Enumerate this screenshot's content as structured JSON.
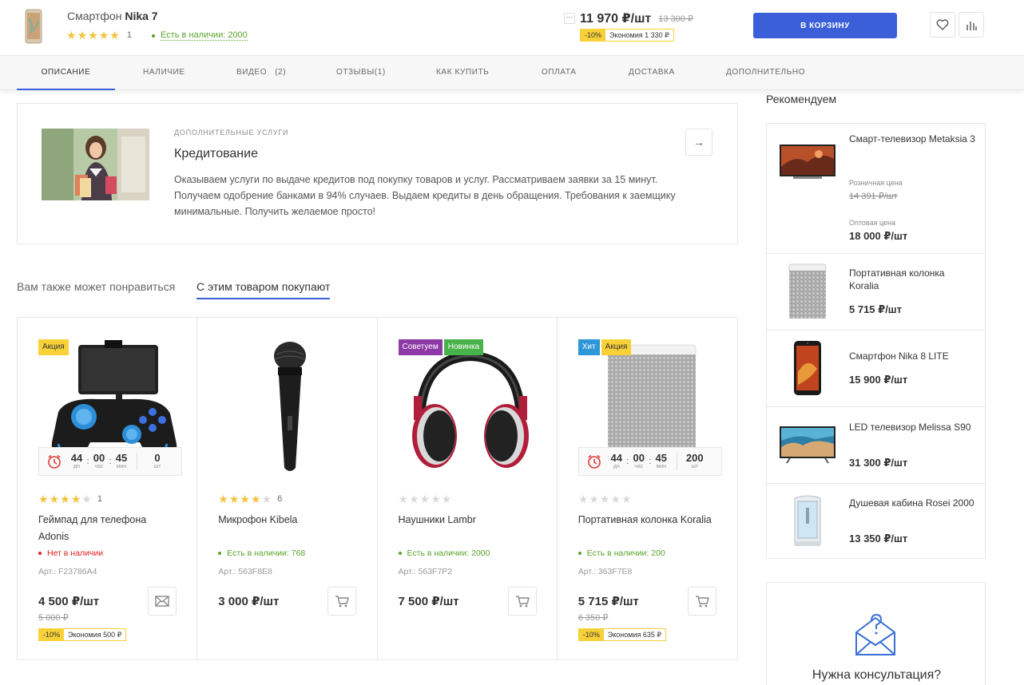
{
  "topbar": {
    "title_prefix": "Смартфон",
    "title_name": "Nika 7",
    "rating": 5,
    "reviews": "1",
    "stock": "Есть в наличии: 2000",
    "dots": "···",
    "price": "11 970 ₽/шт",
    "old_price": "13 300 ₽",
    "discount": "-10%",
    "savings": "Экономия 1 330 ₽",
    "cart_label": "В КОРЗИНУ"
  },
  "tabs": [
    {
      "label": "ОПИСАНИЕ",
      "active": true
    },
    {
      "label": "НАЛИЧИЕ"
    },
    {
      "label": "ВИДЕО   (2)"
    },
    {
      "label": "ОТЗЫВЫ(1)"
    },
    {
      "label": "КАК КУПИТЬ"
    },
    {
      "label": "ОПЛАТА"
    },
    {
      "label": "ДОСТАВКА"
    },
    {
      "label": "ДОПОЛНИТЕЛЬНО"
    }
  ],
  "credit": {
    "subtitle": "ДОПОЛНИТЕЛЬНЫЕ УСЛУГИ",
    "title": "Кредитование",
    "text": "Оказываем услуги по выдаче кредитов под покупку товаров и услуг. Рассматриваем заявки за 15 минут. Получаем одобрение банками в 94% случаев. Выдаем кредиты в день обращения. Требования к заемщику минимальные. Получить желаемое просто!"
  },
  "sections": {
    "tab1": "Вам также может понравиться",
    "tab2": "С этим товаром покупают"
  },
  "products": [
    {
      "badges": [
        {
          "label": "Акция",
          "type": "sale"
        }
      ],
      "timer": {
        "d": "44",
        "dl": "дн",
        "h": "00",
        "hl": "час",
        "m": "45",
        "ml": "мин",
        "q": "0",
        "ql": "шт"
      },
      "rating": 4,
      "reviews": "1",
      "name": "Геймпад для телефона Adonis",
      "stock": "Нет в наличии",
      "in_stock": false,
      "art": "Арт.: F23786A4",
      "price": "4 500 ₽/шт",
      "old_price": "5 000 ₽",
      "discount": "-10%",
      "savings": "Экономия 500 ₽",
      "button_icon": "mail-icon"
    },
    {
      "badges": [],
      "rating": 4,
      "reviews": "6",
      "name": "Микрофон Kibela",
      "stock": "Есть в наличии: 768",
      "in_stock": true,
      "art": "Арт.: 563F8E8",
      "price": "3 000 ₽/шт",
      "button_icon": "cart-icon"
    },
    {
      "badges": [
        {
          "label": "Советуем",
          "type": "rec"
        },
        {
          "label": "Новинка",
          "type": "new"
        }
      ],
      "rating": 0,
      "reviews": "",
      "name": "Наушники Lambr",
      "stock": "Есть в наличии: 2000",
      "in_stock": true,
      "art": "Арт.: 563F7P2",
      "price": "7 500 ₽/шт",
      "button_icon": "cart-icon"
    },
    {
      "badges": [
        {
          "label": "Хит",
          "type": "hit"
        },
        {
          "label": "Акция",
          "type": "sale"
        }
      ],
      "timer": {
        "d": "44",
        "dl": "дн",
        "h": "00",
        "hl": "час",
        "m": "45",
        "ml": "мин",
        "q": "200",
        "ql": "шт"
      },
      "rating": 0,
      "reviews": "",
      "name": "Портативная колонка Koralia",
      "stock": "Есть в наличии: 200",
      "in_stock": true,
      "art": "Арт.: 363F7E8",
      "price": "5 715 ₽/шт",
      "old_price": "6 350 ₽",
      "discount": "-10%",
      "savings": "Экономия 635 ₽",
      "button_icon": "cart-icon"
    }
  ],
  "sidebar": {
    "title": "Рекомендуем",
    "items": [
      {
        "name": "Смарт-телевизор Metaksia 3",
        "retail_label": "Розничная цена",
        "retail_price": "14 391 ₽/шт",
        "wholesale_label": "Оптовая цена",
        "price": "18 000 ₽/шт"
      },
      {
        "name": "Портативная колонка Koralia",
        "price": "5 715 ₽/шт"
      },
      {
        "name": "Смартфон Nika 8 LITE",
        "price": "15 900 ₽/шт"
      },
      {
        "name": "LED телевизор Melissa S90",
        "price": "31 300 ₽/шт"
      },
      {
        "name": "Душевая кабина Rosei 2000",
        "price": "13 350 ₽/шт"
      }
    ]
  },
  "consult": {
    "text": "Нужна консультация?"
  },
  "colors": {
    "accent": "#3a5fd9",
    "in_stock": "#5aa42b",
    "out_of_stock": "#e02020",
    "star": "#f3c33b",
    "discount": "#f7d137"
  }
}
